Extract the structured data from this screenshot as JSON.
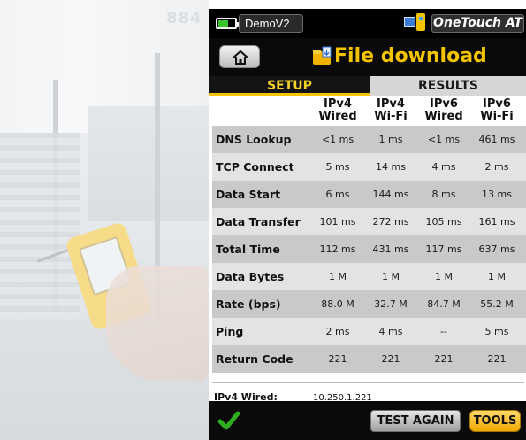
{
  "background": {
    "photo_number": "884"
  },
  "status_bar": {
    "profile_name": "DemoV2",
    "brand": "OneTouch AT",
    "battery_icon": "battery-icon",
    "network_icon": "network-status-icon"
  },
  "title_bar": {
    "title": "File download",
    "home_icon": "home-icon",
    "folder_icon": "folder-icon"
  },
  "tabs": [
    {
      "label": "SETUP",
      "active": false
    },
    {
      "label": "RESULTS",
      "active": true
    }
  ],
  "results_table": {
    "columns": [
      {
        "line1": "IPv4",
        "line2": "Wired"
      },
      {
        "line1": "IPv4",
        "line2": "Wi-Fi"
      },
      {
        "line1": "IPv6",
        "line2": "Wired"
      },
      {
        "line1": "IPv6",
        "line2": "Wi-Fi"
      }
    ],
    "rows": [
      {
        "label": "DNS Lookup",
        "values": [
          "<1 ms",
          "1 ms",
          "<1 ms",
          "461 ms"
        ]
      },
      {
        "label": "TCP Connect",
        "values": [
          "5 ms",
          "14 ms",
          "4 ms",
          "2 ms"
        ]
      },
      {
        "label": "Data Start",
        "values": [
          "6 ms",
          "144 ms",
          "8 ms",
          "13 ms"
        ]
      },
      {
        "label": "Data Transfer",
        "values": [
          "101 ms",
          "272 ms",
          "105 ms",
          "161 ms"
        ]
      },
      {
        "label": "Total Time",
        "values": [
          "112 ms",
          "431 ms",
          "117 ms",
          "637 ms"
        ]
      },
      {
        "label": "Data Bytes",
        "values": [
          "1 M",
          "1 M",
          "1 M",
          "1 M"
        ]
      },
      {
        "label": "Rate (bps)",
        "values": [
          "88.0 M",
          "32.7 M",
          "84.7 M",
          "55.2 M"
        ]
      },
      {
        "label": "Ping",
        "values": [
          "2 ms",
          "4 ms",
          "--",
          "5 ms"
        ]
      },
      {
        "label": "Return Code",
        "values": [
          "221",
          "221",
          "221",
          "221"
        ]
      }
    ]
  },
  "detail": {
    "label": "IPv4 Wired:",
    "value": "10.250.1.221"
  },
  "bottom_bar": {
    "status_icon": "checkmark-icon",
    "test_again_label": "TEST AGAIN",
    "tools_label": "TOOLS"
  },
  "colors": {
    "accent_yellow": "#f5c400",
    "bar_black": "#0a0a0a",
    "row_dark": "#c9c9c9",
    "row_light": "#e3e3e3",
    "check_green": "#2fae1f"
  }
}
